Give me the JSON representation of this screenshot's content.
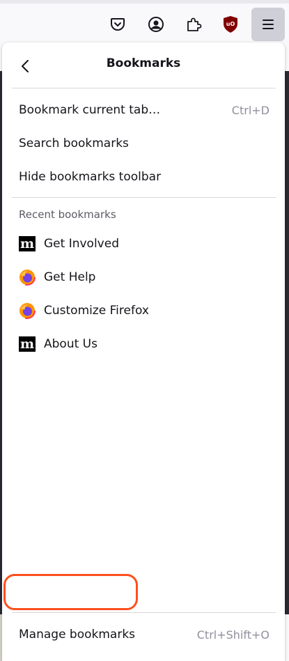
{
  "toolbar": {
    "buttons": [
      {
        "name": "pocket-icon"
      },
      {
        "name": "account-icon"
      },
      {
        "name": "extensions-icon"
      },
      {
        "name": "ublock-origin-icon",
        "label": "uO"
      },
      {
        "name": "hamburger-menu-icon"
      }
    ]
  },
  "panel": {
    "title": "Bookmarks",
    "actions": [
      {
        "label": "Bookmark current tab…",
        "shortcut": "Ctrl+D"
      },
      {
        "label": "Search bookmarks",
        "shortcut": ""
      },
      {
        "label": "Hide bookmarks toolbar",
        "shortcut": ""
      }
    ],
    "recent_label": "Recent bookmarks",
    "recent": [
      {
        "label": "Get Involved",
        "icon": "mozilla-icon",
        "glyph": "m"
      },
      {
        "label": "Get Help",
        "icon": "firefox-icon"
      },
      {
        "label": "Customize Firefox",
        "icon": "firefox-icon"
      },
      {
        "label": "About Us",
        "icon": "mozilla-icon",
        "glyph": "m"
      }
    ],
    "footer": {
      "label": "Manage bookmarks",
      "shortcut": "Ctrl+Shift+O"
    }
  },
  "colors": {
    "highlight": "#ff4f1e",
    "ublock": "#800000",
    "active_button": "#cfcfd8"
  }
}
